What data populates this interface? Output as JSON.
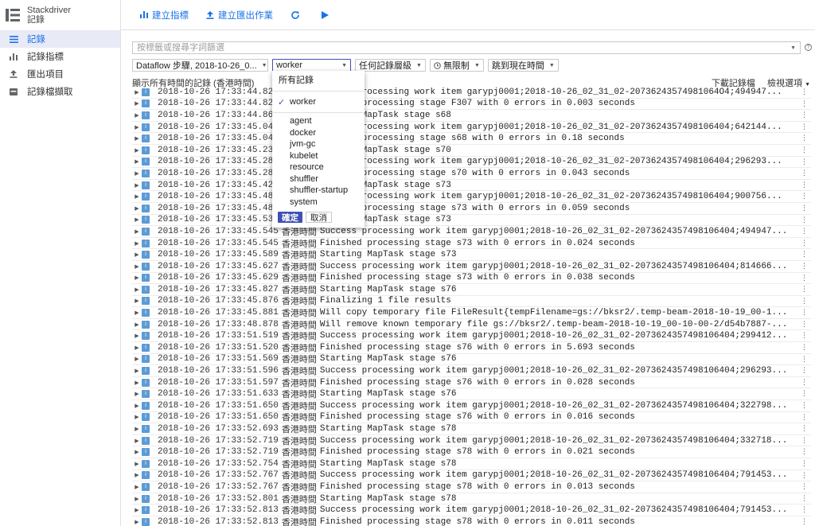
{
  "app": {
    "name": "Stackdriver",
    "section": "記錄"
  },
  "sidebar": {
    "items": [
      {
        "label": "記錄",
        "icon": "list-icon",
        "active": true
      },
      {
        "label": "記錄指標",
        "icon": "bar-chart-icon",
        "active": false
      },
      {
        "label": "匯出項目",
        "icon": "upload-icon",
        "active": false
      },
      {
        "label": "記錄檔擷取",
        "icon": "storage-icon",
        "active": false
      }
    ]
  },
  "toolbar": {
    "create_metric": "建立指標",
    "create_export": "建立匯出作業",
    "refresh_icon": "refresh-icon",
    "play_icon": "play-icon"
  },
  "filter": {
    "placeholder": "按標籤或搜尋字詞篩選"
  },
  "selectors": {
    "resource": "Dataflow 步驟, 2018-10-26_0...",
    "log": "worker",
    "severity": "任何記錄層級",
    "limit": "無限制",
    "jump": "跳到現在時間"
  },
  "log_header": {
    "title": "顯示所有時間的記錄 (香港時間)",
    "download": "下載記錄檔",
    "view_options": "檢視選項"
  },
  "menu": {
    "all": "所有記錄",
    "checked": "worker",
    "options": [
      "agent",
      "docker",
      "jvm-gc",
      "kubelet",
      "resource",
      "shuffler",
      "shuffler-startup",
      "system"
    ],
    "ok": "確定",
    "cancel": "取消"
  },
  "colors": {
    "accent": "#1a73e8",
    "menu_accent": "#3f51b5",
    "severity_info": "#5c9bd6"
  },
  "logs": {
    "date": "2018-10-26",
    "zone": "香港時間",
    "severity": "i",
    "rows": [
      {
        "time": "17:33:44.82",
        "msg": "Success processing work item garypj0001;2018-10-26_02_31_02-20736243574981064O4;494947..."
      },
      {
        "time": "17:33:44.82",
        "msg": "Finished processing stage F307 with 0 errors in 0.003 seconds"
      },
      {
        "time": "17:33:44.86",
        "msg": "Starting MapTask stage s68"
      },
      {
        "time": "17:33:45.04",
        "msg": "Success processing work item garypj0001;2018-10-26_02_31_02-2073624357498106404;642144..."
      },
      {
        "time": "17:33:45.04",
        "msg": "Finished processing stage s68 with 0 errors in 0.18 seconds"
      },
      {
        "time": "17:33:45.23",
        "msg": "Starting MapTask stage s70"
      },
      {
        "time": "17:33:45.28",
        "msg": "Success processing work item garypj0001;2018-10-26_02_31_02-2073624357498106404;296293..."
      },
      {
        "time": "17:33:45.28",
        "msg": "Finished processing stage s70 with 0 errors in 0.043 seconds"
      },
      {
        "time": "17:33:45.42",
        "msg": "Starting MapTask stage s73"
      },
      {
        "time": "17:33:45.48",
        "msg": "Success processing work item garypj0001;2018-10-26_02_31_02-2073624357498106404;900756..."
      },
      {
        "time": "17:33:45.48",
        "msg": "Finished processing stage s73 with 0 errors in 0.059 seconds"
      },
      {
        "time": "17:33:45.53",
        "msg": "Starting MapTask stage s73"
      },
      {
        "time": "17:33:45.545",
        "msg": "Success processing work item garypj0001;2018-10-26_02_31_02-2073624357498106404;494947..."
      },
      {
        "time": "17:33:45.545",
        "msg": "Finished processing stage s73 with 0 errors in 0.024 seconds"
      },
      {
        "time": "17:33:45.589",
        "msg": "Starting MapTask stage s73"
      },
      {
        "time": "17:33:45.627",
        "msg": "Success processing work item garypj0001;2018-10-26_02_31_02-2073624357498106404;814666..."
      },
      {
        "time": "17:33:45.629",
        "msg": "Finished processing stage s73 with 0 errors in 0.038 seconds"
      },
      {
        "time": "17:33:45.827",
        "msg": "Starting MapTask stage s76"
      },
      {
        "time": "17:33:45.876",
        "msg": "Finalizing 1 file results"
      },
      {
        "time": "17:33:45.881",
        "msg": "Will copy temporary file FileResult{tempFilename=gs://bksr2/.temp-beam-2018-10-19_00-1..."
      },
      {
        "time": "17:33:48.878",
        "msg": "Will remove known temporary file gs://bksr2/.temp-beam-2018-10-19_00-10-00-2/d54b7887-..."
      },
      {
        "time": "17:33:51.519",
        "msg": "Success processing work item garypj0001;2018-10-26_02_31_02-2073624357498106404;299412..."
      },
      {
        "time": "17:33:51.520",
        "msg": "Finished processing stage s76 with 0 errors in 5.693 seconds"
      },
      {
        "time": "17:33:51.569",
        "msg": "Starting MapTask stage s76"
      },
      {
        "time": "17:33:51.596",
        "msg": "Success processing work item garypj0001;2018-10-26_02_31_02-2073624357498106404;296293..."
      },
      {
        "time": "17:33:51.597",
        "msg": "Finished processing stage s76 with 0 errors in 0.028 seconds"
      },
      {
        "time": "17:33:51.633",
        "msg": "Starting MapTask stage s76"
      },
      {
        "time": "17:33:51.650",
        "msg": "Success processing work item garypj0001;2018-10-26_02_31_02-2073624357498106404;322798..."
      },
      {
        "time": "17:33:51.650",
        "msg": "Finished processing stage s76 with 0 errors in 0.016 seconds"
      },
      {
        "time": "17:33:52.693",
        "msg": "Starting MapTask stage s78"
      },
      {
        "time": "17:33:52.719",
        "msg": "Success processing work item garypj0001;2018-10-26_02_31_02-2073624357498106404;332718..."
      },
      {
        "time": "17:33:52.719",
        "msg": "Finished processing stage s78 with 0 errors in 0.021 seconds"
      },
      {
        "time": "17:33:52.754",
        "msg": "Starting MapTask stage s78"
      },
      {
        "time": "17:33:52.767",
        "msg": "Success processing work item garypj0001;2018-10-26_02_31_02-2073624357498106404;791453..."
      },
      {
        "time": "17:33:52.767",
        "msg": "Finished processing stage s78 with 0 errors in 0.013 seconds"
      },
      {
        "time": "17:33:52.801",
        "msg": "Starting MapTask stage s78"
      },
      {
        "time": "17:33:52.813",
        "msg": "Success processing work item garypj0001;2018-10-26_02_31_02-2073624357498106404;791453..."
      },
      {
        "time": "17:33:52.813",
        "msg": "Finished processing stage s78 with 0 errors in 0.011 seconds"
      }
    ]
  }
}
